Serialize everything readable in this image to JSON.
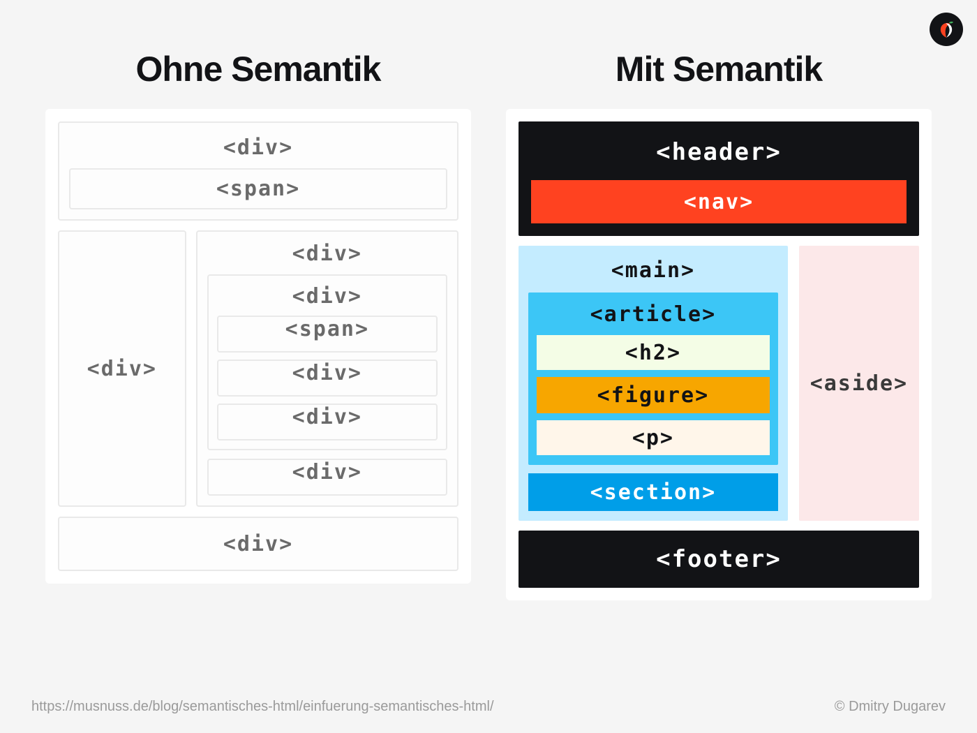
{
  "logo_name": "nut-logo",
  "left": {
    "title": "Ohne Semantik",
    "header_tag": "<div>",
    "header_inner": "<span>",
    "sidebar": "<div>",
    "main_tag": "<div>",
    "article_tag": "<div>",
    "article_items": [
      "<span>",
      "<div>",
      "<div>"
    ],
    "section": "<div>",
    "footer": "<div>"
  },
  "right": {
    "title": "Mit Semantik",
    "header": "<header>",
    "nav": "<nav>",
    "main": "<main>",
    "article": "<article>",
    "h2": "<h2>",
    "figure": "<figure>",
    "p": "<p>",
    "section": "<section>",
    "aside": "<aside>",
    "footer": "<footer>"
  },
  "footer_url": "https://musnuss.de/blog/semantisches-html/einfuerung-semantisches-html/",
  "footer_credit": "© Dmitry Dugarev"
}
